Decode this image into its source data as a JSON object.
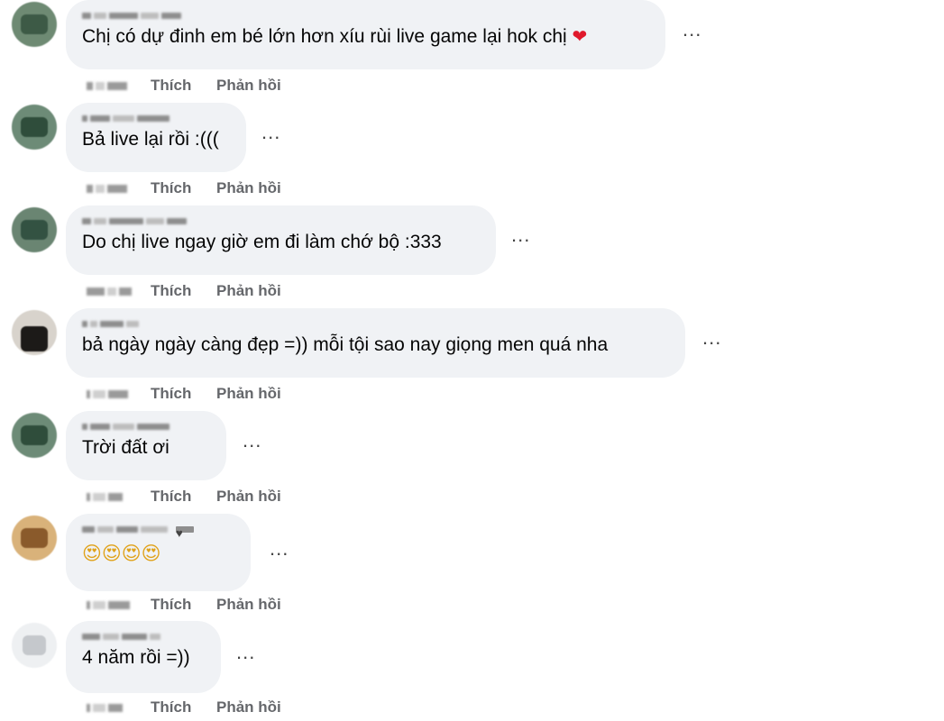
{
  "comments": [
    {
      "text": "Chị có dự đinh em bé lớn hơn xíu rùi live game lại hok chị",
      "like": "Thích",
      "reply": "Phản hồi",
      "more": "...",
      "reaction_icon": "red-heart-icon"
    },
    {
      "text": "Bả live lại rồi :(((",
      "like": "Thích",
      "reply": "Phản hồi",
      "more": "..."
    },
    {
      "text": "Do chị live ngay giờ em đi làm chớ bộ :333",
      "like": "Thích",
      "reply": "Phản hồi",
      "more": "..."
    },
    {
      "text": "bả ngày ngày càng đẹp =)) mỗi tội sao nay giọng men quá nha",
      "like": "Thích",
      "reply": "Phản hồi",
      "more": "..."
    },
    {
      "text": "Trời đất ơi",
      "like": "Thích",
      "reply": "Phản hồi",
      "more": "..."
    },
    {
      "text": "😍😍😍😍",
      "like": "Thích",
      "reply": "Phản hồi",
      "more": "...",
      "author_badge_icon": "heart-badge-icon"
    },
    {
      "text": "4 năm rồi =))",
      "like": "Thích",
      "reply": "Phản hồi",
      "more": "..."
    }
  ],
  "colors": {
    "bubble": "#f0f2f5",
    "action_text": "#65676b",
    "heart": "#e0192c"
  }
}
